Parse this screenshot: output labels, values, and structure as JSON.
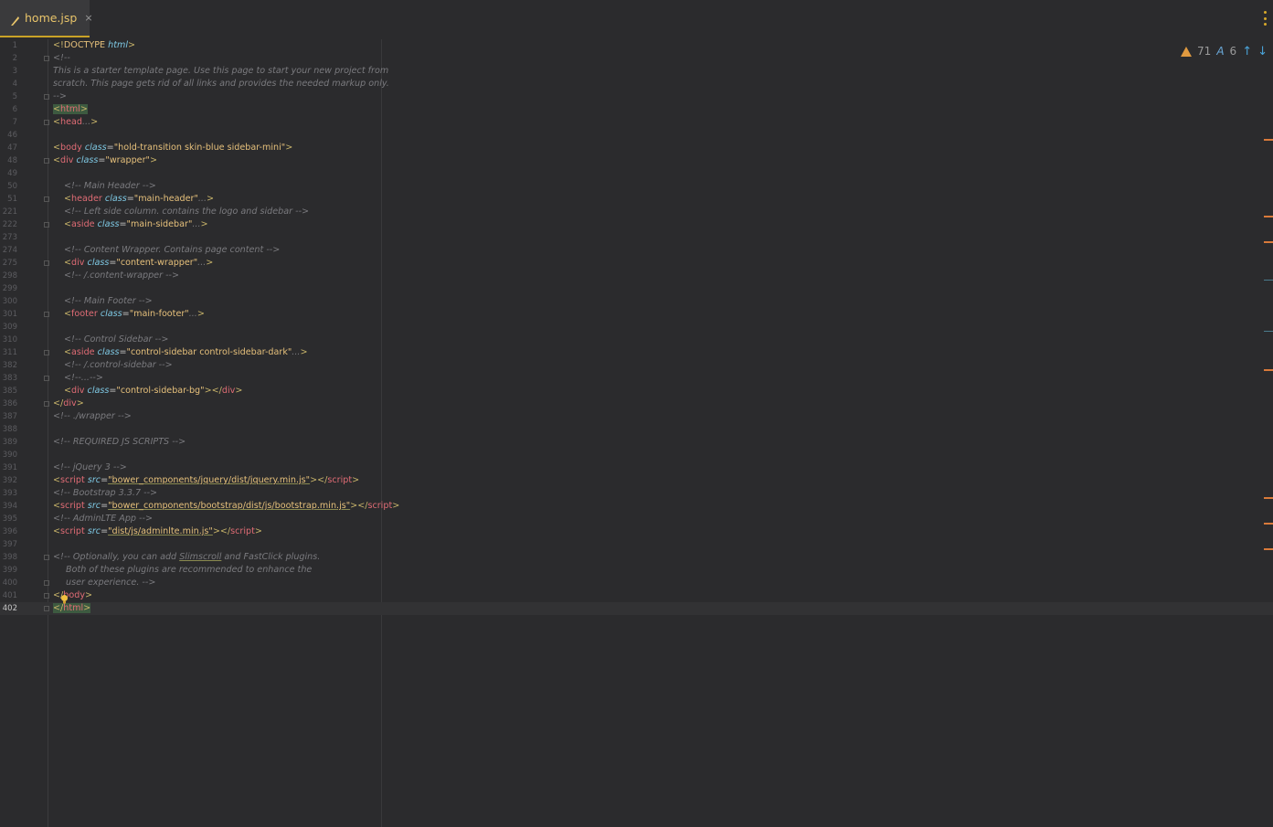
{
  "tab": {
    "title": "home.jsp",
    "close": "×",
    "icon": "jsp-file-icon"
  },
  "inspections": {
    "warnings": "71",
    "typos": "6",
    "up": "↑",
    "down": "↓"
  },
  "lines": [
    {
      "n": "1",
      "html": "<span class='brk'>&lt;!</span><span class='doc'>DOCTYPE</span> <span class='attr'>html</span><span class='brk'>&gt;</span>",
      "fold": false,
      "indent": 0
    },
    {
      "n": "2",
      "html": "<span class='cmt'>&lt;!--</span>",
      "fold": true,
      "indent": 0
    },
    {
      "n": "3",
      "html": "<span class='cmt'>This is a starter template page. Use this page to start your new project from</span>",
      "fold": false,
      "indent": 0
    },
    {
      "n": "4",
      "html": "<span class='cmt'>scratch. This page gets rid of all links and provides the needed markup only.</span>",
      "fold": false,
      "indent": 0
    },
    {
      "n": "5",
      "html": "<span class='cmt'>--&gt;</span>",
      "fold": true,
      "indent": 0
    },
    {
      "n": "6",
      "html": "<span class='hl'><span class='brk'>&lt;</span><span class='tag'>html</span><span class='brk'>&gt;</span></span>",
      "fold": false,
      "indent": 0
    },
    {
      "n": "7",
      "html": "<span class='brk'>&lt;</span><span class='tag'>head</span><span class='cmt'>...</span><span class='brk'>&gt;</span>",
      "fold": true,
      "indent": 0
    },
    {
      "n": "46",
      "html": "",
      "fold": false,
      "indent": 0
    },
    {
      "n": "47",
      "html": "<span class='brk'>&lt;</span><span class='tag'>body</span> <span class='attr'>class</span><span class='eq'>=</span><span class='val'>\"hold-transition skin-blue sidebar-mini\"</span><span class='brk'>&gt;</span>",
      "fold": false,
      "indent": 0
    },
    {
      "n": "48",
      "html": "<span class='brk'>&lt;</span><span class='tag'>div</span> <span class='attr'>class</span><span class='eq'>=</span><span class='val'>\"wrapper\"</span><span class='brk'>&gt;</span>",
      "fold": true,
      "indent": 0
    },
    {
      "n": "49",
      "html": "",
      "fold": false,
      "indent": 0
    },
    {
      "n": "50",
      "html": "<span class='cmt'>&lt;!-- Main Header --&gt;</span>",
      "fold": false,
      "indent": 1
    },
    {
      "n": "51",
      "html": "<span class='brk'>&lt;</span><span class='tag'>header</span> <span class='attr'>class</span><span class='eq'>=</span><span class='val'>\"main-header\"</span><span class='cmt'>...</span><span class='brk'>&gt;</span>",
      "fold": true,
      "indent": 1
    },
    {
      "n": "221",
      "html": "<span class='cmt'>&lt;!-- Left side column. contains the logo and sidebar --&gt;</span>",
      "fold": false,
      "indent": 1
    },
    {
      "n": "222",
      "html": "<span class='brk'>&lt;</span><span class='tag'>aside</span> <span class='attr'>class</span><span class='eq'>=</span><span class='val'>\"main-sidebar\"</span><span class='cmt'>...</span><span class='brk'>&gt;</span>",
      "fold": true,
      "indent": 1
    },
    {
      "n": "273",
      "html": "",
      "fold": false,
      "indent": 0
    },
    {
      "n": "274",
      "html": "<span class='cmt'>&lt;!-- Content Wrapper. Contains page content --&gt;</span>",
      "fold": false,
      "indent": 1
    },
    {
      "n": "275",
      "html": "<span class='brk'>&lt;</span><span class='tag'>div</span> <span class='attr'>class</span><span class='eq'>=</span><span class='val'>\"content-wrapper\"</span><span class='cmt'>...</span><span class='brk'>&gt;</span>",
      "fold": true,
      "indent": 1
    },
    {
      "n": "298",
      "html": "<span class='cmt'>&lt;!-- /.content-wrapper --&gt;</span>",
      "fold": false,
      "indent": 1
    },
    {
      "n": "299",
      "html": "",
      "fold": false,
      "indent": 0
    },
    {
      "n": "300",
      "html": "<span class='cmt'>&lt;!-- Main Footer --&gt;</span>",
      "fold": false,
      "indent": 1
    },
    {
      "n": "301",
      "html": "<span class='brk'>&lt;</span><span class='tag'>footer</span> <span class='attr'>class</span><span class='eq'>=</span><span class='val'>\"main-footer\"</span><span class='cmt'>...</span><span class='brk'>&gt;</span>",
      "fold": true,
      "indent": 1
    },
    {
      "n": "309",
      "html": "",
      "fold": false,
      "indent": 0
    },
    {
      "n": "310",
      "html": "<span class='cmt'>&lt;!-- Control Sidebar --&gt;</span>",
      "fold": false,
      "indent": 1
    },
    {
      "n": "311",
      "html": "<span class='brk'>&lt;</span><span class='tag'>aside</span> <span class='attr'>class</span><span class='eq'>=</span><span class='val'>\"control-sidebar control-sidebar-dark\"</span><span class='cmt'>...</span><span class='brk'>&gt;</span>",
      "fold": true,
      "indent": 1
    },
    {
      "n": "382",
      "html": "<span class='cmt'>&lt;!-- /.control-sidebar --&gt;</span>",
      "fold": false,
      "indent": 1
    },
    {
      "n": "383",
      "html": "<span class='cmt'>&lt;!--...--&gt;</span>",
      "fold": true,
      "indent": 1
    },
    {
      "n": "385",
      "html": "<span class='brk'>&lt;</span><span class='tag'>div</span> <span class='attr'>class</span><span class='eq'>=</span><span class='val'>\"control-sidebar-bg\"</span><span class='brk'>&gt;&lt;/</span><span class='tag'>div</span><span class='brk'>&gt;</span>",
      "fold": false,
      "indent": 1
    },
    {
      "n": "386",
      "html": "<span class='brk'>&lt;/</span><span class='tag'>div</span><span class='brk'>&gt;</span>",
      "fold": true,
      "indent": 0
    },
    {
      "n": "387",
      "html": "<span class='cmt'>&lt;!-- ./wrapper --&gt;</span>",
      "fold": false,
      "indent": 0
    },
    {
      "n": "388",
      "html": "",
      "fold": false,
      "indent": 0
    },
    {
      "n": "389",
      "html": "<span class='cmt'>&lt;!-- REQUIRED JS SCRIPTS --&gt;</span>",
      "fold": false,
      "indent": 0
    },
    {
      "n": "390",
      "html": "",
      "fold": false,
      "indent": 0
    },
    {
      "n": "391",
      "html": "<span class='cmt'>&lt;!-- jQuery 3 --&gt;</span>",
      "fold": false,
      "indent": 0
    },
    {
      "n": "392",
      "html": "<span class='brk'>&lt;</span><span class='tag'>script</span> <span class='attr'>src</span><span class='eq'>=</span><span class='val ul'>\"bower_components/jquery/dist/jquery.min.js\"</span><span class='brk'>&gt;&lt;/</span><span class='tag'>script</span><span class='brk'>&gt;</span>",
      "fold": false,
      "indent": 0
    },
    {
      "n": "393",
      "html": "<span class='cmt'>&lt;!-- Bootstrap 3.3.7 --&gt;</span>",
      "fold": false,
      "indent": 0
    },
    {
      "n": "394",
      "html": "<span class='brk'>&lt;</span><span class='tag'>script</span> <span class='attr'>src</span><span class='eq'>=</span><span class='val ul'>\"bower_components/bootstrap/dist/js/bootstrap.min.js\"</span><span class='brk'>&gt;&lt;/</span><span class='tag'>script</span><span class='brk'>&gt;</span>",
      "fold": false,
      "indent": 0
    },
    {
      "n": "395",
      "html": "<span class='cmt'>&lt;!-- AdminLTE App --&gt;</span>",
      "fold": false,
      "indent": 0
    },
    {
      "n": "396",
      "html": "<span class='brk'>&lt;</span><span class='tag'>script</span> <span class='attr'>src</span><span class='eq'>=</span><span class='val ul'>\"dist/js/adminlte.min.js\"</span><span class='brk'>&gt;&lt;/</span><span class='tag'>script</span><span class='brk'>&gt;</span>",
      "fold": false,
      "indent": 0
    },
    {
      "n": "397",
      "html": "",
      "fold": false,
      "indent": 0
    },
    {
      "n": "398",
      "html": "<span class='cmt'>&lt;!-- Optionally, you can add <span class='ul'>Slimscroll</span> and FastClick plugins.</span>",
      "fold": true,
      "indent": 0
    },
    {
      "n": "399",
      "html": "<span class='cmt'>Both of these plugins are recommended to enhance the</span>",
      "fold": false,
      "indent": 2
    },
    {
      "n": "400",
      "html": "<span class='cmt'>user experience. --&gt;</span>",
      "fold": true,
      "indent": 2
    },
    {
      "n": "401",
      "html": "<span class='brk'>&lt;/</span><span class='tag'>body</span><span class='brk'>&gt;</span>",
      "fold": true,
      "indent": 0
    },
    {
      "n": "402",
      "html": "<span class='hl'><span class='brk'>&lt;/</span><span class='tag'>html</span><span class='brk'>&gt;</span></span>",
      "fold": true,
      "indent": 0,
      "current": true
    }
  ]
}
